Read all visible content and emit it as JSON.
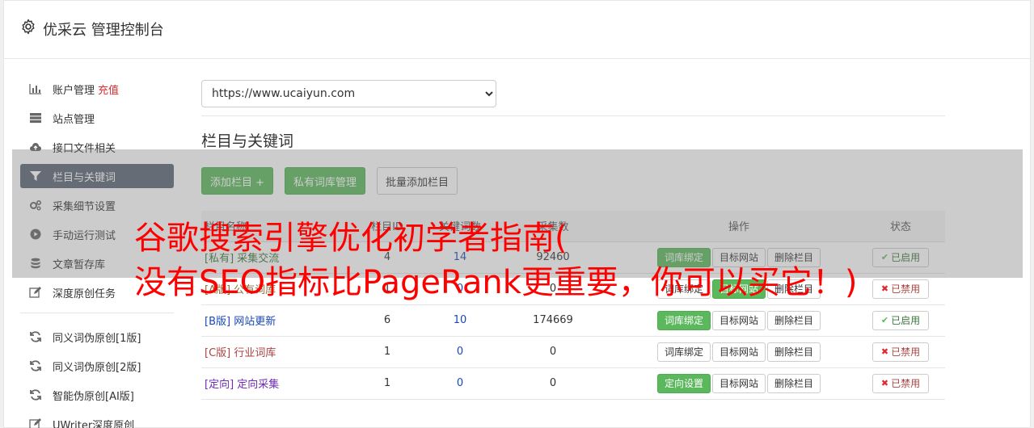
{
  "header": {
    "title": "优采云 管理控制台"
  },
  "sidebar": {
    "items": [
      {
        "label": "账户管理",
        "badge": "充值",
        "icon": "bar-chart-icon"
      },
      {
        "label": "站点管理",
        "icon": "server-icon"
      },
      {
        "label": "接口文件相关",
        "icon": "cloud-upload-icon"
      },
      {
        "label": "栏目与关键词",
        "icon": "filter-icon",
        "active": true
      },
      {
        "label": "采集细节设置",
        "icon": "gears-icon"
      },
      {
        "label": "手动运行测试",
        "icon": "play-circle-icon"
      },
      {
        "label": "文章暂存库",
        "icon": "database-icon"
      },
      {
        "label": "深度原创任务",
        "icon": "edit-icon"
      }
    ],
    "items2": [
      {
        "label": "同义词伪原创[1版]",
        "icon": "refresh-icon"
      },
      {
        "label": "同义词伪原创[2版]",
        "icon": "refresh-icon"
      },
      {
        "label": "智能伪原创[AI版]",
        "icon": "refresh-icon"
      },
      {
        "label": "UWriter深度原创",
        "icon": "edit-icon"
      }
    ]
  },
  "main": {
    "site_select": {
      "value": "https://www.ucaiyun.com"
    },
    "section_title": "栏目与关键词",
    "toolbar": {
      "add_column": "添加栏目 +",
      "private_lib": "私有词库管理",
      "batch_add": "批量添加栏目"
    },
    "table": {
      "headers": [
        "栏目名称",
        "栏目ID",
        "关键词数",
        "采集数",
        "操作",
        "状态"
      ],
      "rows": [
        {
          "tag": "[私有]",
          "name": "采集交流",
          "id": "4",
          "keywords": "14",
          "collected": "92460",
          "action1": "词库绑定",
          "action1_green": true,
          "action2": "目标网站",
          "action2_green": false,
          "action3": "删除栏目",
          "status": "已启用",
          "enabled": true,
          "tag_class": "tag-private"
        },
        {
          "tag": "[A版]",
          "name": "公有词库",
          "id": "1",
          "keywords": "0",
          "collected": "0",
          "action1": "词库绑定",
          "action1_green": false,
          "action2": "目标网站",
          "action2_green": true,
          "action3": "删除栏目",
          "status": "已禁用",
          "enabled": false,
          "tag_class": "tag-a"
        },
        {
          "tag": "[B版]",
          "name": "网站更新",
          "id": "6",
          "keywords": "10",
          "collected": "174669",
          "action1": "词库绑定",
          "action1_green": true,
          "action2": "目标网站",
          "action2_green": false,
          "action3": "删除栏目",
          "status": "已启用",
          "enabled": true,
          "tag_class": "tag-b"
        },
        {
          "tag": "[C版]",
          "name": "行业词库",
          "id": "1",
          "keywords": "0",
          "collected": "0",
          "action1": "词库绑定",
          "action1_green": false,
          "action2": "目标网站",
          "action2_green": false,
          "action3": "删除栏目",
          "status": "已禁用",
          "enabled": false,
          "tag_class": "tag-c"
        },
        {
          "tag": "[定向]",
          "name": "定向采集",
          "id": "1",
          "keywords": "0",
          "collected": "0",
          "action1": "定向设置",
          "action1_green": true,
          "action2": "目标网站",
          "action2_green": false,
          "action3": "删除栏目",
          "status": "已禁用",
          "enabled": false,
          "tag_class": "tag-fixed"
        }
      ]
    }
  },
  "overlay": {
    "line1": "谷歌搜索引擎优化初学者指南(",
    "line2": "没有SEO指标比PageRank更重要，你可以买它！)"
  },
  "colors": {
    "accent_green": "#5cb85c",
    "sidebar_active": "#5b6574",
    "danger": "#e0282e",
    "watermark": "#ff0000"
  }
}
